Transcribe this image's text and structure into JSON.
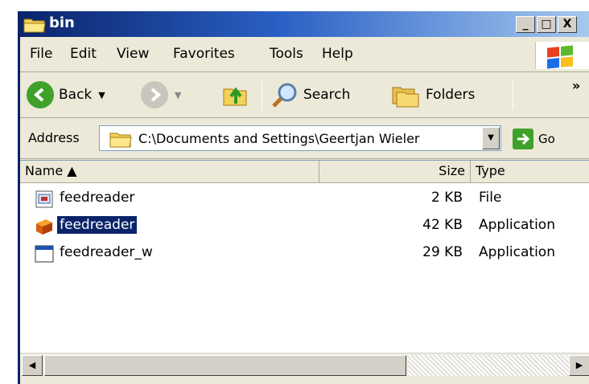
{
  "window": {
    "title": "bin",
    "minimize": "_",
    "maximize": "□",
    "close": "X"
  },
  "menu": [
    "File",
    "Edit",
    "View",
    "Favorites",
    "Tools",
    "Help"
  ],
  "toolbar": {
    "back": "Back",
    "search": "Search",
    "folders": "Folders",
    "more": "»"
  },
  "address": {
    "label": "Address",
    "value": "C:\\Documents and Settings\\Geertjan Wieler",
    "go": "Go"
  },
  "columns": {
    "name": "Name ▲",
    "size": "Size",
    "type": "Type"
  },
  "files": [
    {
      "name": "feedreader",
      "size": "2 KB",
      "type": "File",
      "icon": "generic-file-icon",
      "selected": false
    },
    {
      "name": "feedreader",
      "size": "42 KB",
      "type": "Application",
      "icon": "application-icon",
      "selected": true
    },
    {
      "name": "feedreader_w",
      "size": "29 KB",
      "type": "Application",
      "icon": "window-app-icon",
      "selected": false
    }
  ],
  "colors": {
    "title_start": "#0a246a",
    "title_end": "#a6caf0",
    "selection": "#0a246a",
    "chrome": "#ece9d8"
  }
}
